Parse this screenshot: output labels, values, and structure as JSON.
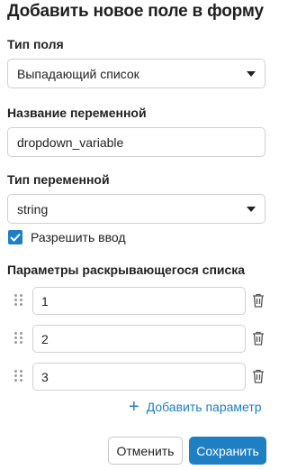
{
  "dialog": {
    "title": "Добавить новое поле в форму"
  },
  "field_type": {
    "label": "Тип поля",
    "value": "Выпадающий список"
  },
  "variable_name": {
    "label": "Название переменной",
    "value": "dropdown_variable"
  },
  "variable_type": {
    "label": "Тип переменной",
    "value": "string"
  },
  "allow_input": {
    "label": "Разрешить ввод",
    "checked": true
  },
  "dropdown_params": {
    "label": "Параметры раскрывающегося списка",
    "items": [
      {
        "value": "1"
      },
      {
        "value": "2"
      },
      {
        "value": "3"
      }
    ],
    "add_label": "Добавить параметр"
  },
  "actions": {
    "cancel_label": "Отменить",
    "save_label": "Сохранить"
  },
  "colors": {
    "accent": "#1e7fc2",
    "border": "#d0d0d0",
    "text": "#222222"
  }
}
